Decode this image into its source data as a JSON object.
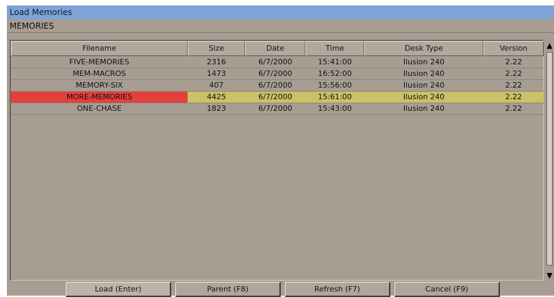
{
  "window": {
    "title": "Load Memories"
  },
  "section": {
    "label": "MEMORIES"
  },
  "table": {
    "columns": [
      "Filename",
      "Size",
      "Date",
      "Time",
      "Desk Type",
      "Version"
    ],
    "rows": [
      [
        "FIVE-MEMORIES",
        "2316",
        "6/7/2000",
        "15:41:00",
        "Ilusion 240",
        "2.22"
      ],
      [
        "MEM-MACROS",
        "1473",
        "6/7/2000",
        "16:52:00",
        "Ilusion 240",
        "2.22"
      ],
      [
        "MEMORY-SIX",
        "407",
        "6/7/2000",
        "15:56:00",
        "Ilusion 240",
        "2.22"
      ],
      [
        "MORE-MEMORIES",
        "4425",
        "6/7/2000",
        "15:61:00",
        "Ilusion 240",
        "2.22"
      ],
      [
        "ONE-CHASE",
        "1823",
        "6/7/2000",
        "15:43:00",
        "Ilusion 240",
        "2.22"
      ]
    ],
    "selected_row": 3
  },
  "scrollbar": {
    "up_icon": "arrow-up-icon",
    "down_icon": "arrow-down-icon"
  },
  "buttons": {
    "load": "Load (Enter)",
    "parent": "Parent (F8)",
    "refresh": "Refresh (F7)",
    "cancel": "Cancel (F9)"
  },
  "colors": {
    "titlebar": "#7fa3d6",
    "window_bg": "#a79d93",
    "selected_row": "#c9c266",
    "selected_name": "#e4403a"
  }
}
